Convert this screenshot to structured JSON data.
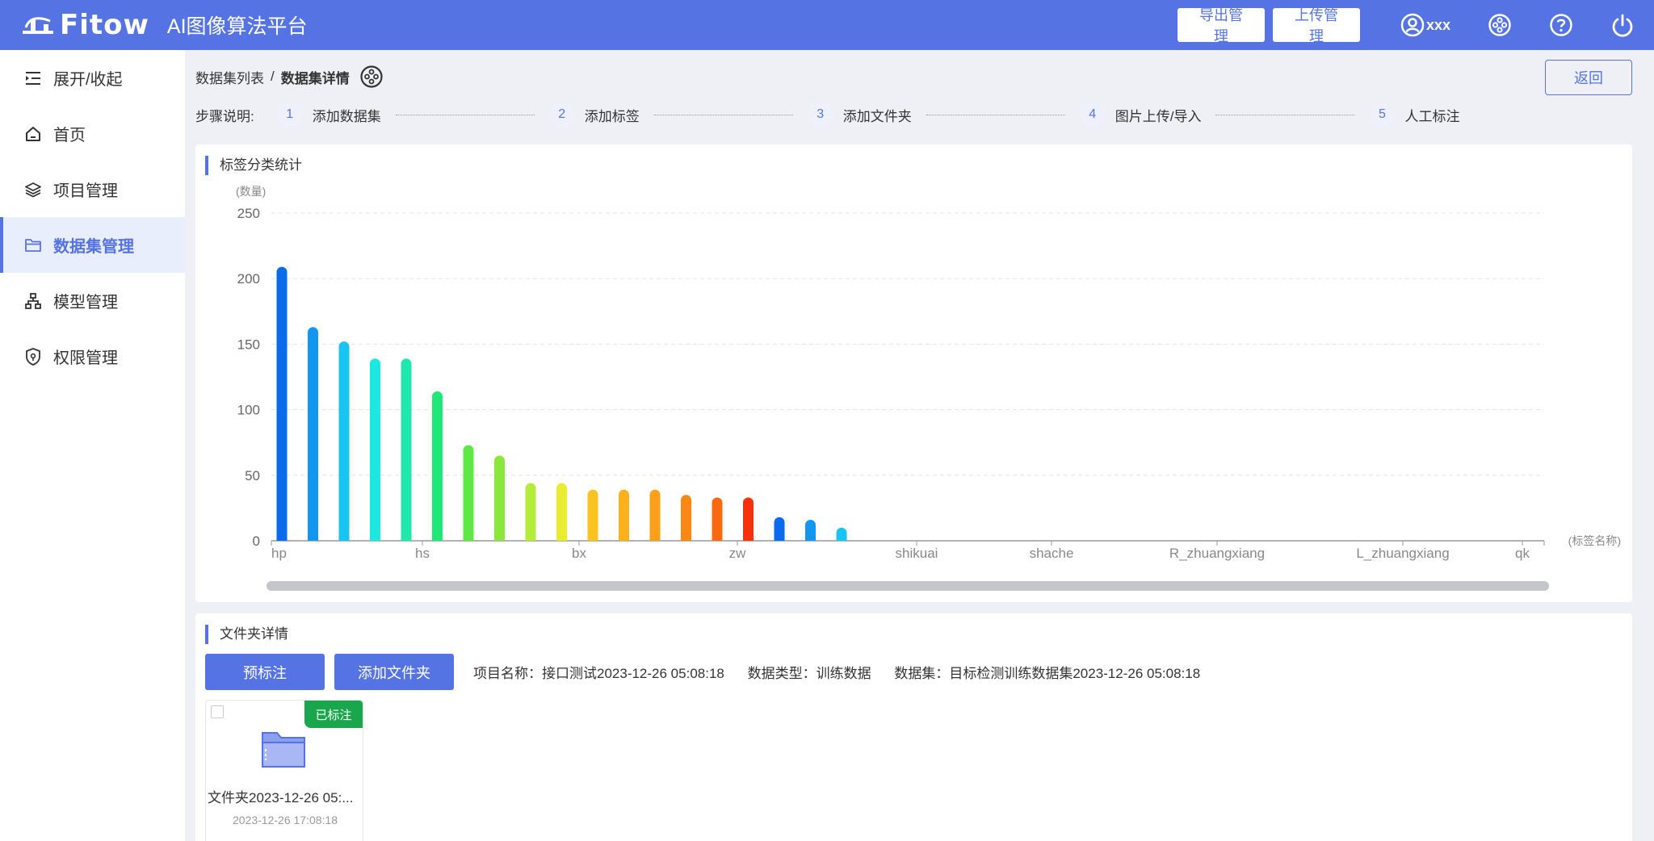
{
  "header": {
    "logo_text": "Fitow",
    "app_title": "AI图像算法平台",
    "export_label": "导出管理",
    "upload_label": "上传管理",
    "user_name": "xxx"
  },
  "sidebar": {
    "items": [
      {
        "label": "展开/收起",
        "icon": "menu-fold-icon"
      },
      {
        "label": "首页",
        "icon": "home-icon"
      },
      {
        "label": "项目管理",
        "icon": "layers-icon"
      },
      {
        "label": "数据集管理",
        "icon": "folder-icon"
      },
      {
        "label": "模型管理",
        "icon": "org-tree-icon"
      },
      {
        "label": "权限管理",
        "icon": "shield-icon"
      }
    ],
    "active_index": 3
  },
  "breadcrumb": {
    "parent": "数据集列表",
    "separator": "/",
    "current": "数据集详情"
  },
  "back_label": "返回",
  "steps": {
    "label": "步骤说明:",
    "items": [
      {
        "num": "1",
        "label": "添加数据集"
      },
      {
        "num": "2",
        "label": "添加标签"
      },
      {
        "num": "3",
        "label": "添加文件夹"
      },
      {
        "num": "4",
        "label": "图片上传/导入"
      },
      {
        "num": "5",
        "label": "人工标注"
      }
    ]
  },
  "chart_card": {
    "title": "标签分类统计"
  },
  "chart_data": {
    "type": "bar",
    "title": "标签分类统计",
    "ylabel": "(数量)",
    "xlabel": "(标签名称)",
    "ylim": [
      0,
      250
    ],
    "yticks": [
      0,
      50,
      100,
      150,
      200,
      250
    ],
    "grid": true,
    "x_tick_labels": [
      "hp",
      "hs",
      "bx",
      "zw",
      "shikuai",
      "shache",
      "R_zhuangxiang",
      "L_zhuangxiang",
      "qk"
    ],
    "values": [
      209,
      163,
      152,
      139,
      139,
      114,
      73,
      65,
      44,
      44,
      39,
      39,
      39,
      35,
      33,
      33,
      18,
      16,
      10
    ],
    "colors": [
      "#0a6bec",
      "#1296f0",
      "#19c3f2",
      "#1ce8e0",
      "#1ee8ac",
      "#1fe878",
      "#5fe845",
      "#8be83a",
      "#b4ec3a",
      "#e9ec30",
      "#fbc321",
      "#fbb11c",
      "#fba018",
      "#fb8714",
      "#fb6a10",
      "#f5320c",
      "#0a6bec",
      "#1296f0",
      "#19c3f2"
    ]
  },
  "folder_card": {
    "title": "文件夹详情",
    "pre_label_button": "预标注",
    "add_folder_button": "添加文件夹",
    "project_name": "项目名称：接口测试2023-12-26 05:08:18",
    "data_type": "数据类型：训练数据",
    "dataset": "数据集：目标检测训练数据集2023-12-26 05:08:18",
    "tiles": [
      {
        "name": "文件夹2023-12-26 05:...",
        "date": "2023-12-26 17:08:18",
        "badge": "已标注"
      }
    ]
  }
}
